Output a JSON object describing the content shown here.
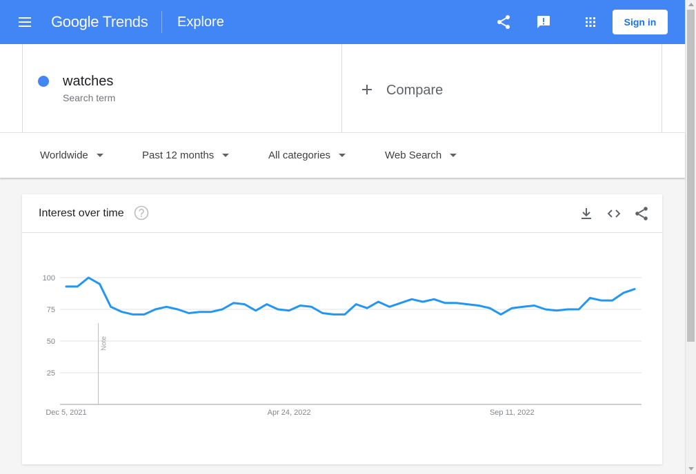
{
  "header": {
    "logo_google": "Google",
    "logo_trends": "Trends",
    "page": "Explore",
    "sign_in": "Sign in"
  },
  "search": {
    "term": "watches",
    "term_type": "Search term",
    "compare": "Compare",
    "term_color": "#4285f4"
  },
  "filters": {
    "region": "Worldwide",
    "time": "Past 12 months",
    "category": "All categories",
    "property": "Web Search"
  },
  "card": {
    "title": "Interest over time"
  },
  "chart_data": {
    "type": "line",
    "x_ticks": [
      "Dec 5, 2021",
      "Apr 24, 2022",
      "Sep 11, 2022"
    ],
    "y_ticks": [
      25,
      50,
      75,
      100
    ],
    "ylim": [
      0,
      100
    ],
    "annotation": "Note",
    "grid": true,
    "series": [
      {
        "name": "watches",
        "color": "#2196f3",
        "values": [
          93,
          93,
          100,
          95,
          77,
          73,
          71,
          71,
          75,
          77,
          75,
          72,
          73,
          73,
          75,
          80,
          79,
          74,
          79,
          75,
          74,
          78,
          77,
          72,
          71,
          71,
          79,
          76,
          81,
          77,
          80,
          83,
          81,
          83,
          80,
          80,
          79,
          78,
          76,
          71,
          76,
          77,
          78,
          75,
          74,
          75,
          75,
          84,
          82,
          82,
          88,
          91
        ]
      }
    ]
  }
}
